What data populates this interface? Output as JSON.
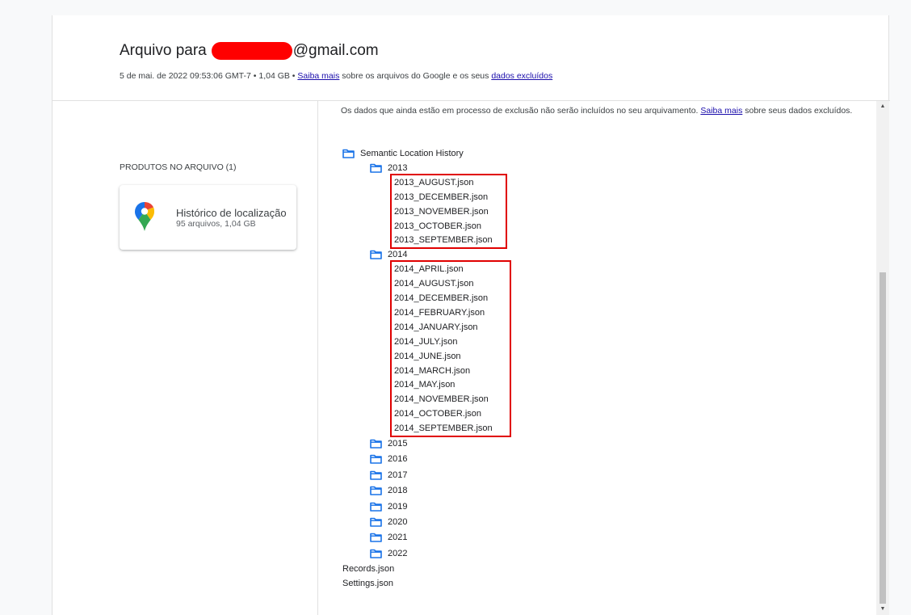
{
  "header": {
    "title_prefix": "Arquivo para",
    "title_suffix": "@gmail.com",
    "subtitle_prefix": "5 de mai. de 2022 09:53:06 GMT-7 • 1,04 GB •",
    "learn_more_link": "Saiba mais",
    "subtitle_middle": "sobre os arquivos do Google e os seus",
    "deleted_data_link": "dados excluídos"
  },
  "sidebar": {
    "products_label": "PRODUTOS NO ARQUIVO (1)",
    "product": {
      "name": "Histórico de localização",
      "meta": "95 arquivos, 1,04 GB",
      "icon": "google-maps-pin-icon"
    }
  },
  "content": {
    "notice_text": "Os dados que ainda estão em processo de exclusão não serão incluídos no seu arquivamento.",
    "notice_link": "Saiba mais",
    "notice_suffix": "sobre seus dados excluídos.",
    "root_folder": "Semantic Location History",
    "folder_2013": "2013",
    "files_2013": [
      "2013_AUGUST.json",
      "2013_DECEMBER.json",
      "2013_NOVEMBER.json",
      "2013_OCTOBER.json",
      "2013_SEPTEMBER.json"
    ],
    "folder_2014": "2014",
    "files_2014": [
      "2014_APRIL.json",
      "2014_AUGUST.json",
      "2014_DECEMBER.json",
      "2014_FEBRUARY.json",
      "2014_JANUARY.json",
      "2014_JULY.json",
      "2014_JUNE.json",
      "2014_MARCH.json",
      "2014_MAY.json",
      "2014_NOVEMBER.json",
      "2014_OCTOBER.json",
      "2014_SEPTEMBER.json"
    ],
    "other_folders": [
      "2015",
      "2016",
      "2017",
      "2018",
      "2019",
      "2020",
      "2021",
      "2022"
    ],
    "root_files": [
      "Records.json",
      "Settings.json"
    ]
  },
  "colors": {
    "highlight_box": "#e00000",
    "redaction": "#ff0000",
    "link": "#1a0dab"
  }
}
